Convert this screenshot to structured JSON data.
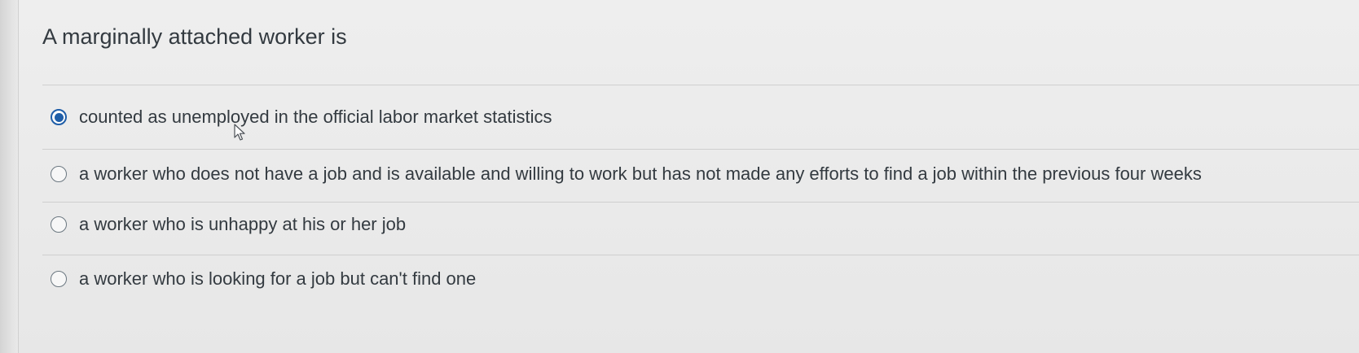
{
  "question": {
    "text": "A marginally attached worker is"
  },
  "answers": [
    {
      "label": "counted as unemployed in the official labor market statistics",
      "selected": true
    },
    {
      "label": "a worker who does not have a job and is available and willing to work but has not made any efforts to find a job within the previous four weeks",
      "selected": false
    },
    {
      "label": "a worker who is unhappy at his or her job",
      "selected": false
    },
    {
      "label": "a worker who is looking for a job but can't find one",
      "selected": false
    }
  ],
  "colors": {
    "selected_radio": "#1f5ea8",
    "text": "#333a40",
    "background": "#ebebeb"
  },
  "icons": {
    "cursor": "mouse-pointer-icon"
  }
}
